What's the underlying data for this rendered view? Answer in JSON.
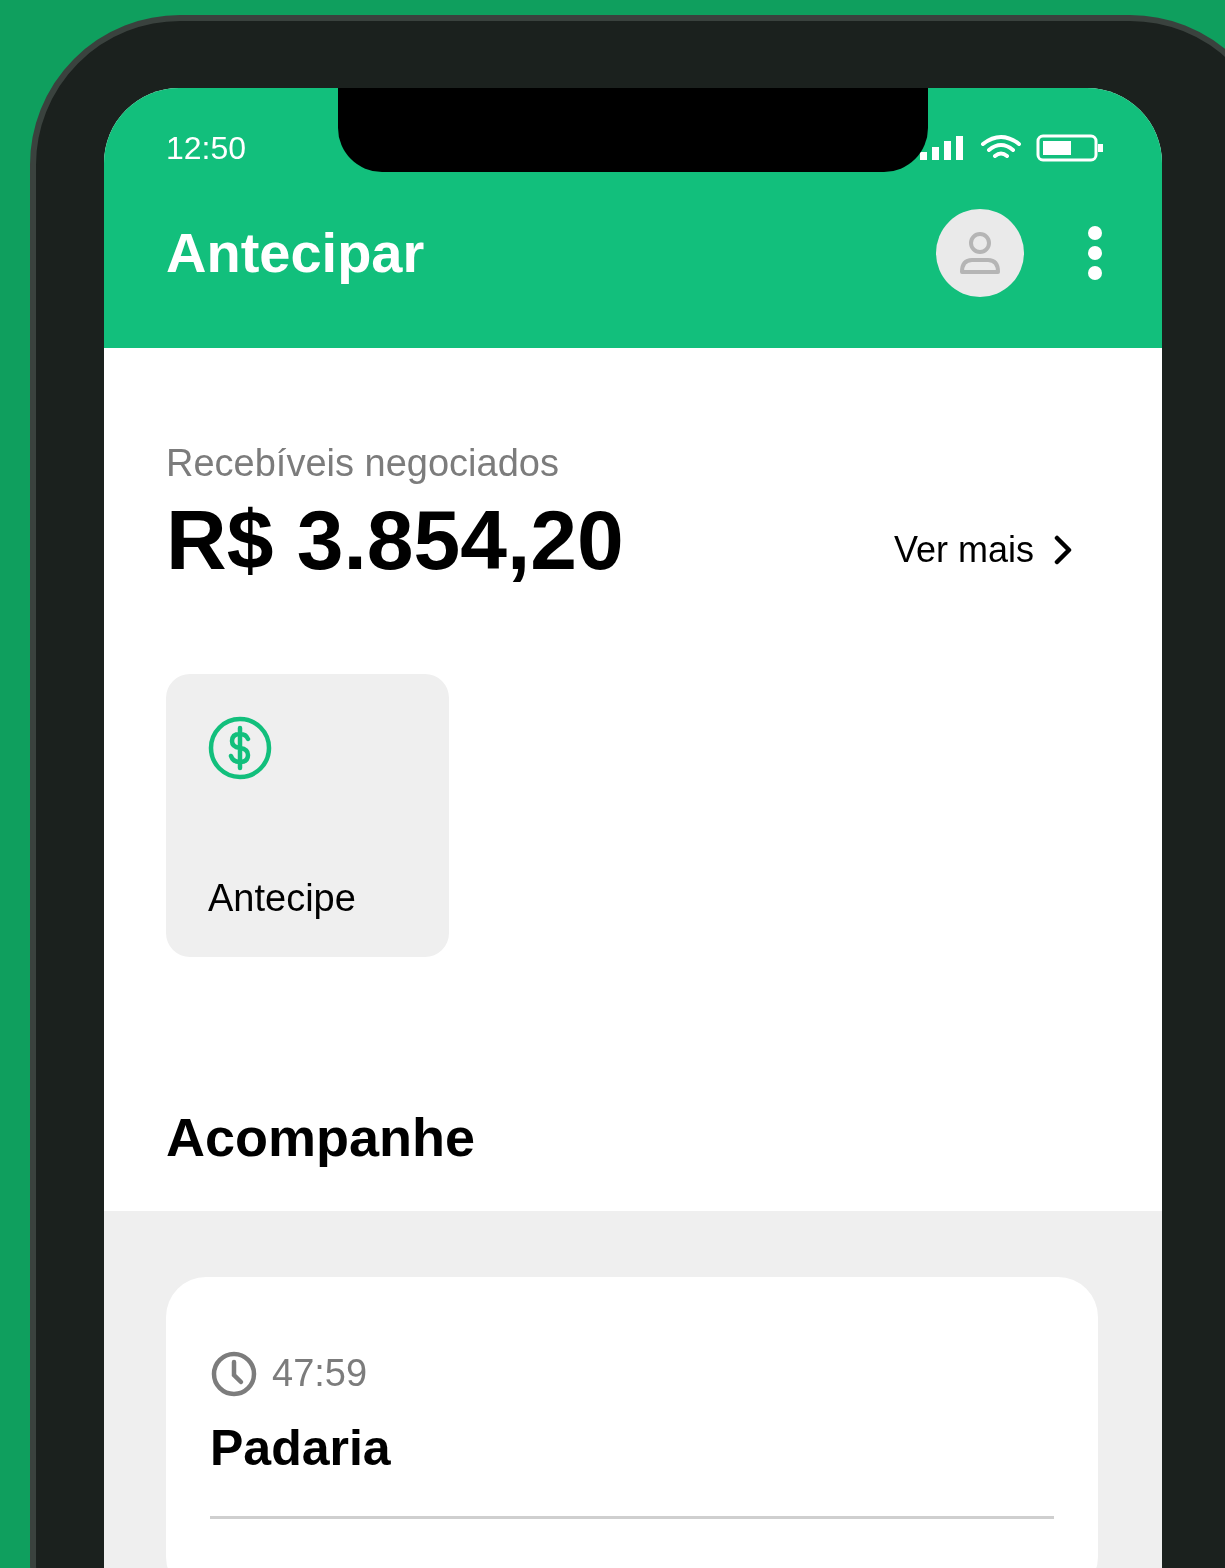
{
  "status_bar": {
    "time": "12:50"
  },
  "app_bar": {
    "title": "Antecipar"
  },
  "summary": {
    "label": "Recebíveis negociados",
    "amount": "R$ 3.854,20",
    "link": "Ver mais"
  },
  "actions": [
    {
      "label": "Antecipe"
    }
  ],
  "section": {
    "title": "Acompanhe"
  },
  "orders": [
    {
      "timer": "47:59",
      "name": "Padaria"
    }
  ]
}
